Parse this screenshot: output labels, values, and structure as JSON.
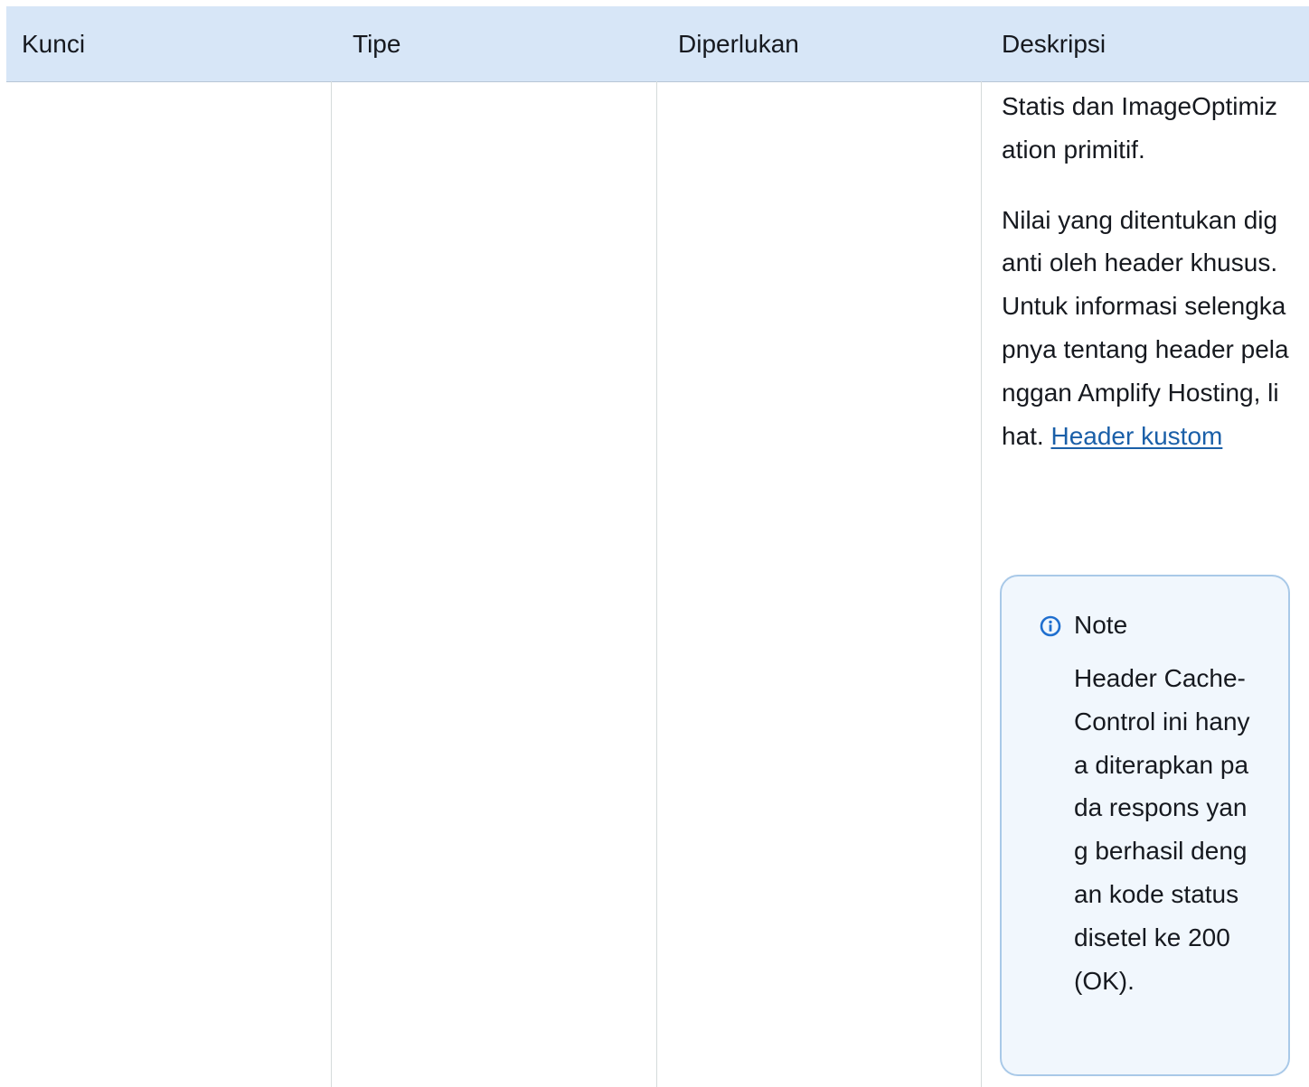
{
  "table": {
    "headers": {
      "key": "Kunci",
      "type": "Tipe",
      "required": "Diperlukan",
      "description": "Deskripsi"
    },
    "description_cell": {
      "paragraph_1": "Statis dan ImageOptimization primitif.",
      "paragraph_2_text": "Nilai yang ditentukan diganti oleh header khusus. Untuk informasi selengkapnya tentang header pelanggan Amplify Hosting, lihat. ",
      "paragraph_2_link": "Header kustom"
    },
    "note": {
      "icon": "info-circle-icon",
      "title": "Note",
      "body": "Header Cache-Control ini hanya diterapkan pada respons yang berhasil dengan kode status disetel ke 200 (OK)."
    }
  },
  "colors": {
    "header_background": "#d7e6f7",
    "link": "#1a5fa8",
    "note_border": "#a9c9e8",
    "note_background": "#f1f7fd",
    "info_icon": "#1f6fcf"
  }
}
